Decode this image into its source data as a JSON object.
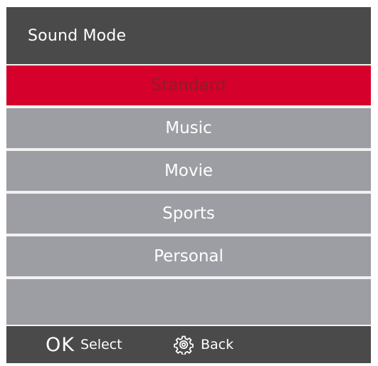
{
  "header": {
    "title": "Sound Mode"
  },
  "menu": {
    "items": [
      {
        "label": "Standard",
        "selected": true
      },
      {
        "label": "Music",
        "selected": false
      },
      {
        "label": "Movie",
        "selected": false
      },
      {
        "label": "Sports",
        "selected": false
      },
      {
        "label": "Personal",
        "selected": false
      },
      {
        "label": "",
        "selected": false
      }
    ]
  },
  "footer": {
    "ok_key": "OK",
    "ok_label": "Select",
    "back_icon": "gear-icon",
    "back_label": "Back"
  },
  "colors": {
    "panel_background": "#4a4a4a",
    "item_background": "#9d9ea4",
    "selected_background": "#d5002b",
    "selected_text": "#8b1e28",
    "divider": "#f2f2f2"
  }
}
